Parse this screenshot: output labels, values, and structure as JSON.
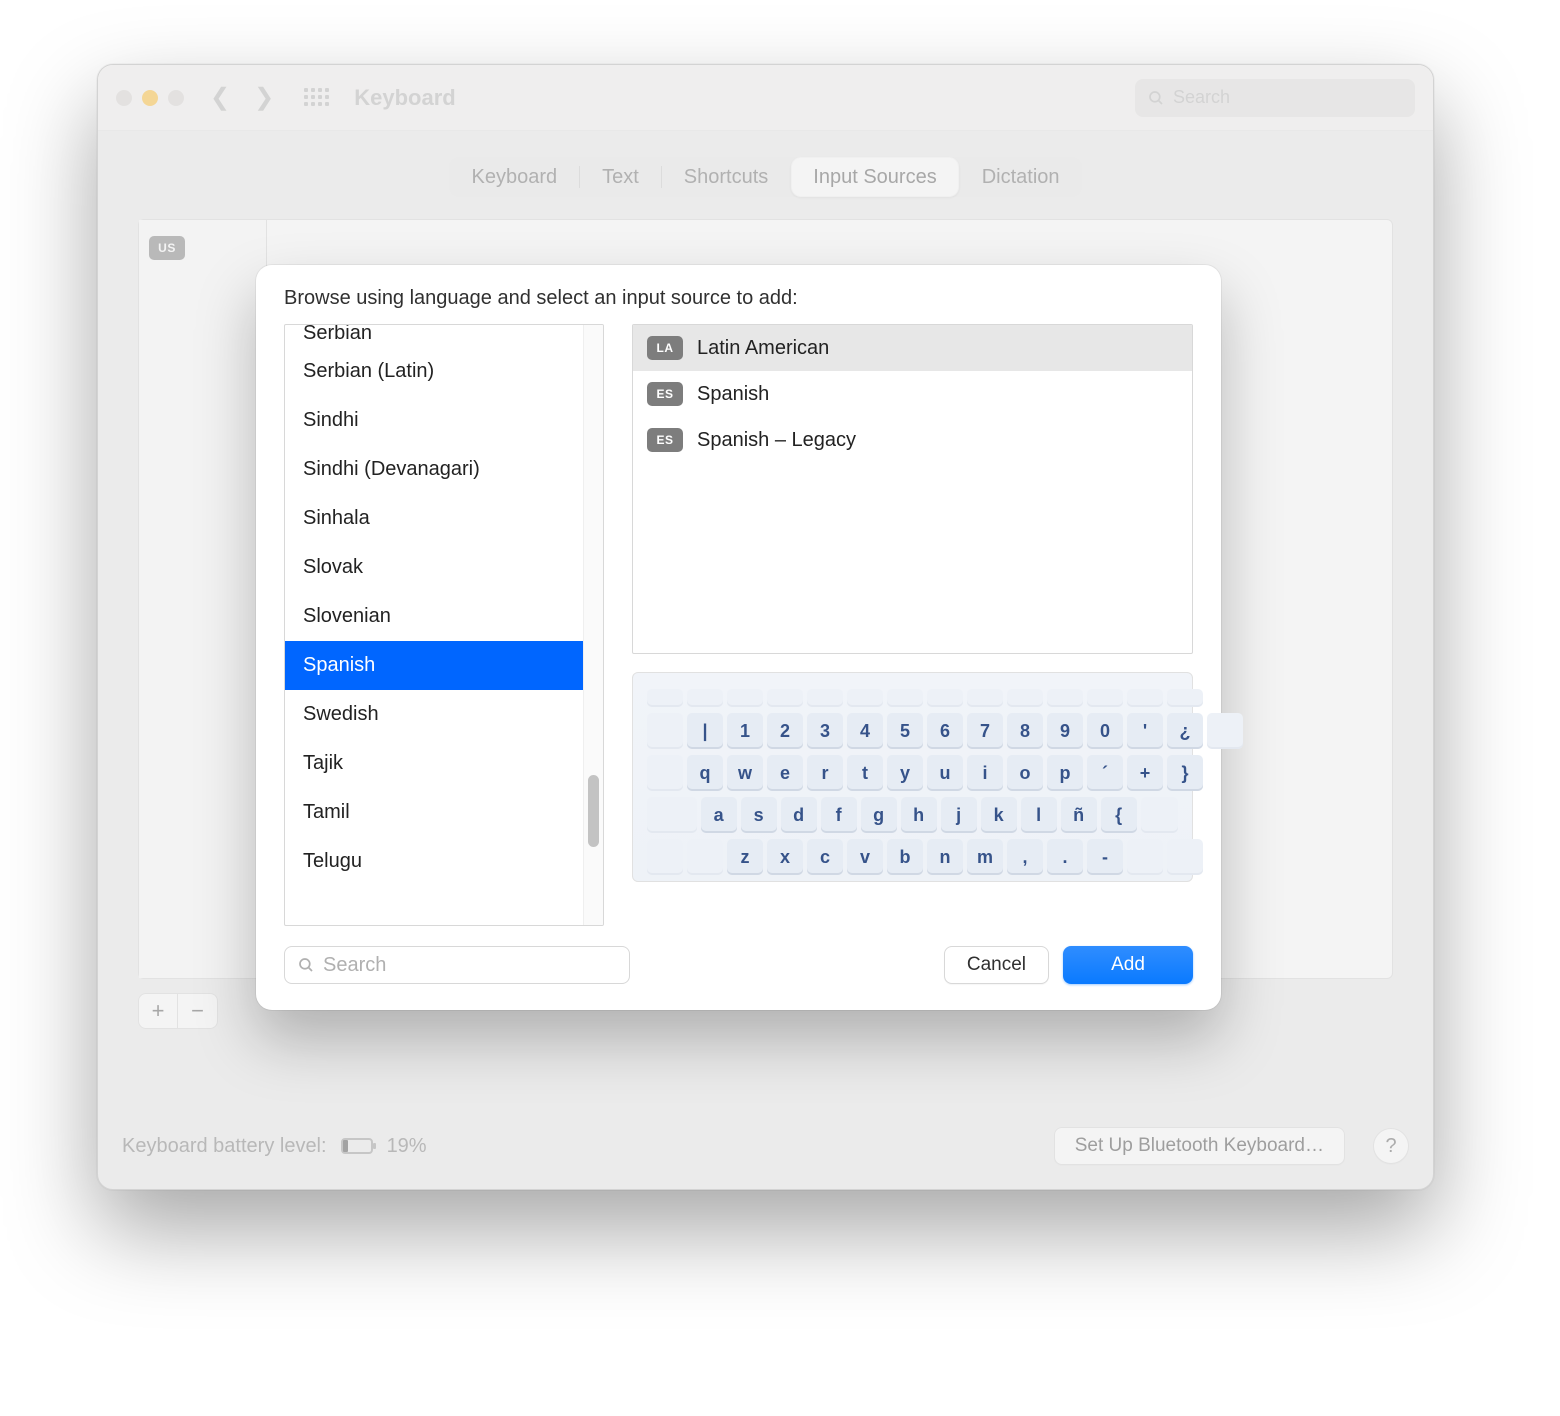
{
  "window": {
    "title": "Keyboard",
    "search_placeholder": "Search"
  },
  "tabs": {
    "items": [
      "Keyboard",
      "Text",
      "Shortcuts",
      "Input Sources",
      "Dictation"
    ],
    "active_index": 3
  },
  "background_source": {
    "chip": "US"
  },
  "footer": {
    "battery_label": "Keyboard battery level:",
    "battery_pct_text": "19%",
    "battery_pct": 19,
    "bluetooth_button": "Set Up Bluetooth Keyboard…",
    "help": "?"
  },
  "modal": {
    "title": "Browse using language and select an input source to add:",
    "languages": [
      "Serbian",
      "Serbian (Latin)",
      "Sindhi",
      "Sindhi (Devanagari)",
      "Sinhala",
      "Slovak",
      "Slovenian",
      "Spanish",
      "Swedish",
      "Tajik",
      "Tamil",
      "Telugu"
    ],
    "selected_language_index": 7,
    "scrollbar": {
      "top_pct": 75,
      "height_pct": 12
    },
    "sources": [
      {
        "chip": "LA",
        "label": "Latin American"
      },
      {
        "chip": "ES",
        "label": "Spanish"
      },
      {
        "chip": "ES",
        "label": "Spanish – Legacy"
      }
    ],
    "selected_source_index": 0,
    "search_placeholder": "Search",
    "cancel": "Cancel",
    "add": "Add"
  },
  "keyboard_preview": {
    "row1": [
      "|",
      "1",
      "2",
      "3",
      "4",
      "5",
      "6",
      "7",
      "8",
      "9",
      "0",
      "'",
      "¿"
    ],
    "row2": [
      "q",
      "w",
      "e",
      "r",
      "t",
      "y",
      "u",
      "i",
      "o",
      "p",
      "´",
      "+",
      "}"
    ],
    "row3": [
      "a",
      "s",
      "d",
      "f",
      "g",
      "h",
      "j",
      "k",
      "l",
      "ñ",
      "{"
    ],
    "row4": [
      "z",
      "x",
      "c",
      "v",
      "b",
      "n",
      "m",
      ",",
      ".",
      "-"
    ]
  }
}
